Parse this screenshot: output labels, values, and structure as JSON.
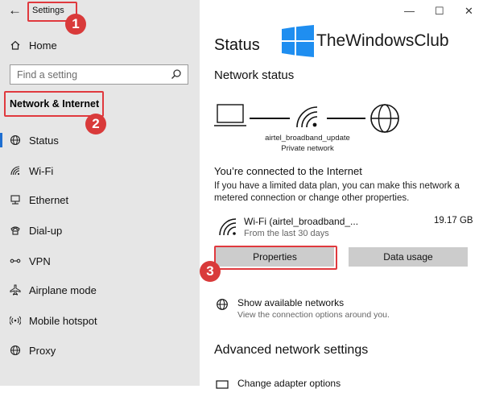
{
  "sidebar": {
    "back_glyph": "←",
    "title": "Settings",
    "home_label": "Home",
    "search_placeholder": "Find a setting",
    "section_label": "Network & Internet",
    "items": [
      {
        "label": "Status",
        "icon": "status-globe-icon",
        "active": true
      },
      {
        "label": "Wi-Fi",
        "icon": "wifi-icon"
      },
      {
        "label": "Ethernet",
        "icon": "ethernet-icon"
      },
      {
        "label": "Dial-up",
        "icon": "dialup-icon"
      },
      {
        "label": "VPN",
        "icon": "vpn-icon"
      },
      {
        "label": "Airplane mode",
        "icon": "airplane-icon"
      },
      {
        "label": "Mobile hotspot",
        "icon": "hotspot-icon"
      },
      {
        "label": "Proxy",
        "icon": "globe-icon"
      }
    ]
  },
  "window_controls": {
    "minimize": "—",
    "maximize": "☐",
    "close": "✕"
  },
  "main": {
    "title": "Status",
    "logo_text": "TheWindowsClub",
    "network_status_heading": "Network status",
    "network_name": "airtel_broadband_update",
    "network_type": "Private network",
    "connected_text": "You’re connected to the Internet",
    "description": "If you have a limited data plan, you can make this network a metered connection or change other properties.",
    "wifi_name": "Wi-Fi (airtel_broadband_...",
    "wifi_period": "From the last 30 days",
    "wifi_usage": "19.17 GB",
    "properties_label": "Properties",
    "data_usage_label": "Data usage",
    "show_networks_title": "Show available networks",
    "show_networks_sub": "View the connection options around you.",
    "advanced_heading": "Advanced network settings",
    "change_adapter_label": "Change adapter options"
  },
  "annotations": {
    "badge1": "1",
    "badge2": "2",
    "badge3": "3"
  },
  "colors": {
    "annotation": "#e0393e",
    "badge": "#d93a3a",
    "accent": "#1f6fd1",
    "button": "#cccccc"
  }
}
